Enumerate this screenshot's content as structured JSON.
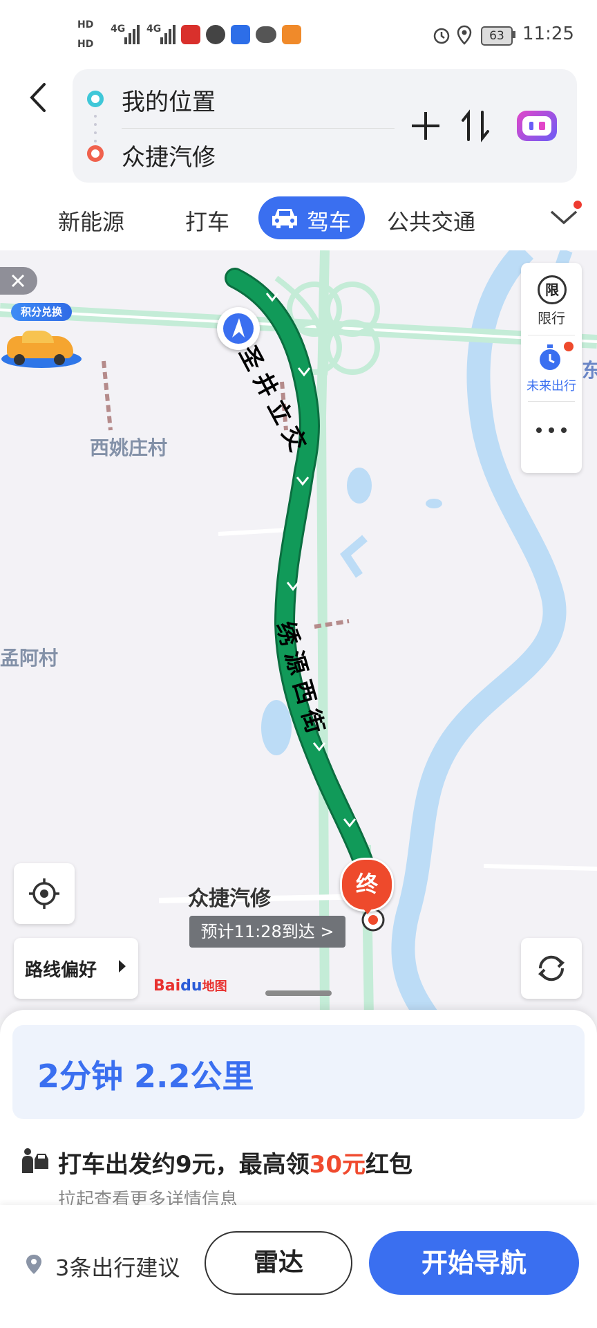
{
  "status_bar": {
    "hd1": "HD",
    "hd2": "HD",
    "net1": "4G",
    "net2": "4G",
    "battery": "63",
    "time": "11:25"
  },
  "route": {
    "origin": "我的位置",
    "destination": "众捷汽修"
  },
  "modes": [
    {
      "label": "新能源"
    },
    {
      "label": "打车"
    },
    {
      "label": "驾车",
      "active": true
    },
    {
      "label": "公共交通"
    }
  ],
  "map": {
    "promo_badge": "积分兑换",
    "village_west": "西姚庄村",
    "village_meng": "孟阿村",
    "east_char": "东",
    "road_1": "圣井立交",
    "road_2": "绣源西街",
    "end_marker": "终",
    "dest_name": "众捷汽修",
    "eta": "预计11:28到达 >",
    "restrict_icon_text": "限",
    "restrict_label": "限行",
    "future_label": "未来出行",
    "route_pref": "路线偏好",
    "logo_bai": "Bai",
    "logo_du": "du",
    "logo_map": "地图"
  },
  "summary": {
    "time": "2分钟",
    "distance": "2.2公里"
  },
  "taxi": {
    "prefix": "打车出发约9元，最高领",
    "highlight": "30元",
    "suffix": "红包",
    "hint": "拉起查看更多详情信息"
  },
  "footer": {
    "suggest": "3条出行建议",
    "radar": "雷达",
    "start": "开始导航"
  },
  "colors": {
    "route_green": "#119a59",
    "accent_blue": "#3a6ff0",
    "end_red": "#ee4a2c",
    "promo_red": "#f04a2e"
  }
}
